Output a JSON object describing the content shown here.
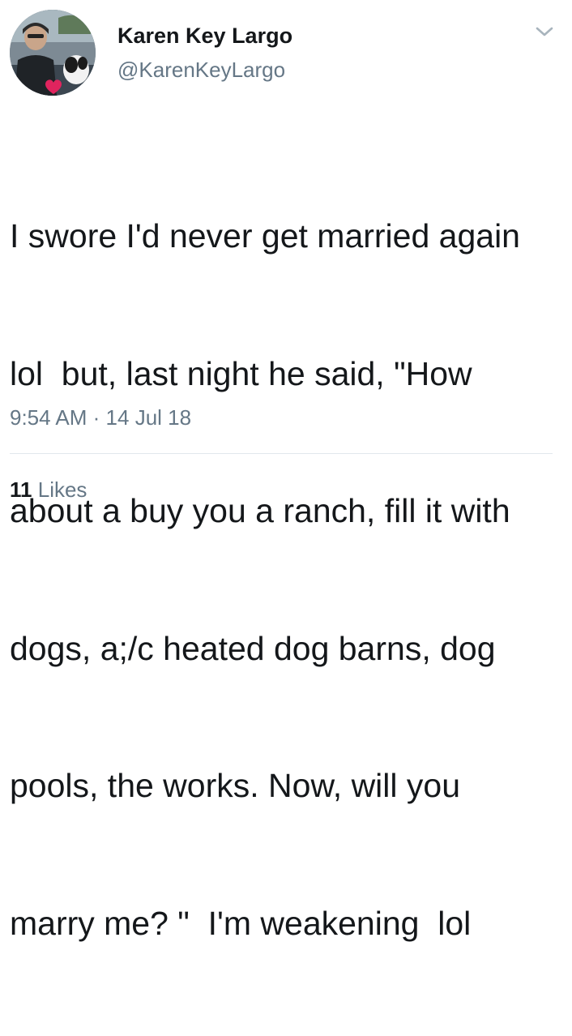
{
  "author": {
    "display_name": "Karen Key Largo",
    "handle": "@KarenKeyLargo",
    "avatar_icon": "profile-photo-icon"
  },
  "menu": {
    "icon": "chevron-down-icon"
  },
  "tweet": {
    "lines": [
      "I swore I'd never get married again",
      "lol  but, last night he said, \"How",
      "about a buy you a ranch, fill it with",
      "dogs, a;/c heated dog barns, dog",
      "pools, the works. Now, will you",
      "marry me? \"  I'm weakening  lol"
    ]
  },
  "meta": {
    "time": "9:54 AM",
    "separator": "·",
    "date": "14 Jul 18"
  },
  "stats": {
    "likes_count": "11",
    "likes_label": "Likes"
  },
  "colors": {
    "primary_text": "#14171a",
    "secondary_text": "#657786",
    "divider": "#e1e8ed",
    "heart": "#e0245e"
  }
}
